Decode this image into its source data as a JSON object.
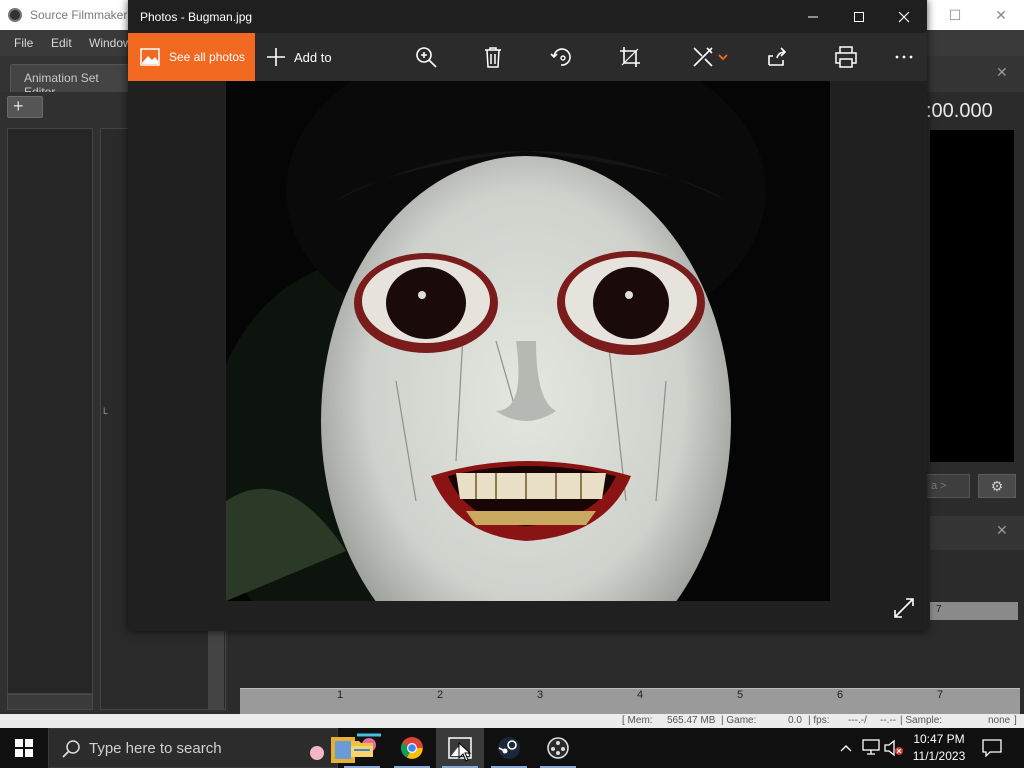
{
  "sfm": {
    "window_title": "Source Filmmaker",
    "menu": [
      "File",
      "Edit",
      "Window"
    ],
    "tab_animation_set_editor": "Animation Set Editor",
    "timecode": ":00.000",
    "dropdown_text": "a >",
    "panel_letter": "L",
    "timeline_ticks": [
      "1",
      "2",
      "3",
      "4",
      "5",
      "6",
      "7"
    ],
    "mini_ruler_tick": "7",
    "status": {
      "mem": "[ Mem:",
      "mem_value": "565.47 MB",
      "game": "| Game:",
      "game_value": "0.0",
      "fps": "| fps:",
      "fps_value": "---.-/",
      "fps_extra": "--.--",
      "sample": "| Sample:",
      "sample_value": "none",
      "end": "]"
    }
  },
  "photos": {
    "title": "Photos - Bugman.jpg",
    "see_all_photos": "See all photos",
    "add_to": "Add to",
    "toolbar_icons": [
      "zoom-icon",
      "delete-icon",
      "rotate-icon",
      "crop-icon",
      "edit-draw-icon",
      "share-icon",
      "print-icon",
      "more-icon"
    ],
    "accent_color": "#f26a21",
    "image_subject": "Bugman"
  },
  "taskbar": {
    "search_placeholder": "Type here to search",
    "apps": [
      "file-explorer-icon",
      "chrome-icon",
      "photos-icon",
      "steam-icon",
      "source-filmmaker-icon"
    ],
    "time": "10:47 PM",
    "date": "11/1/2023"
  }
}
